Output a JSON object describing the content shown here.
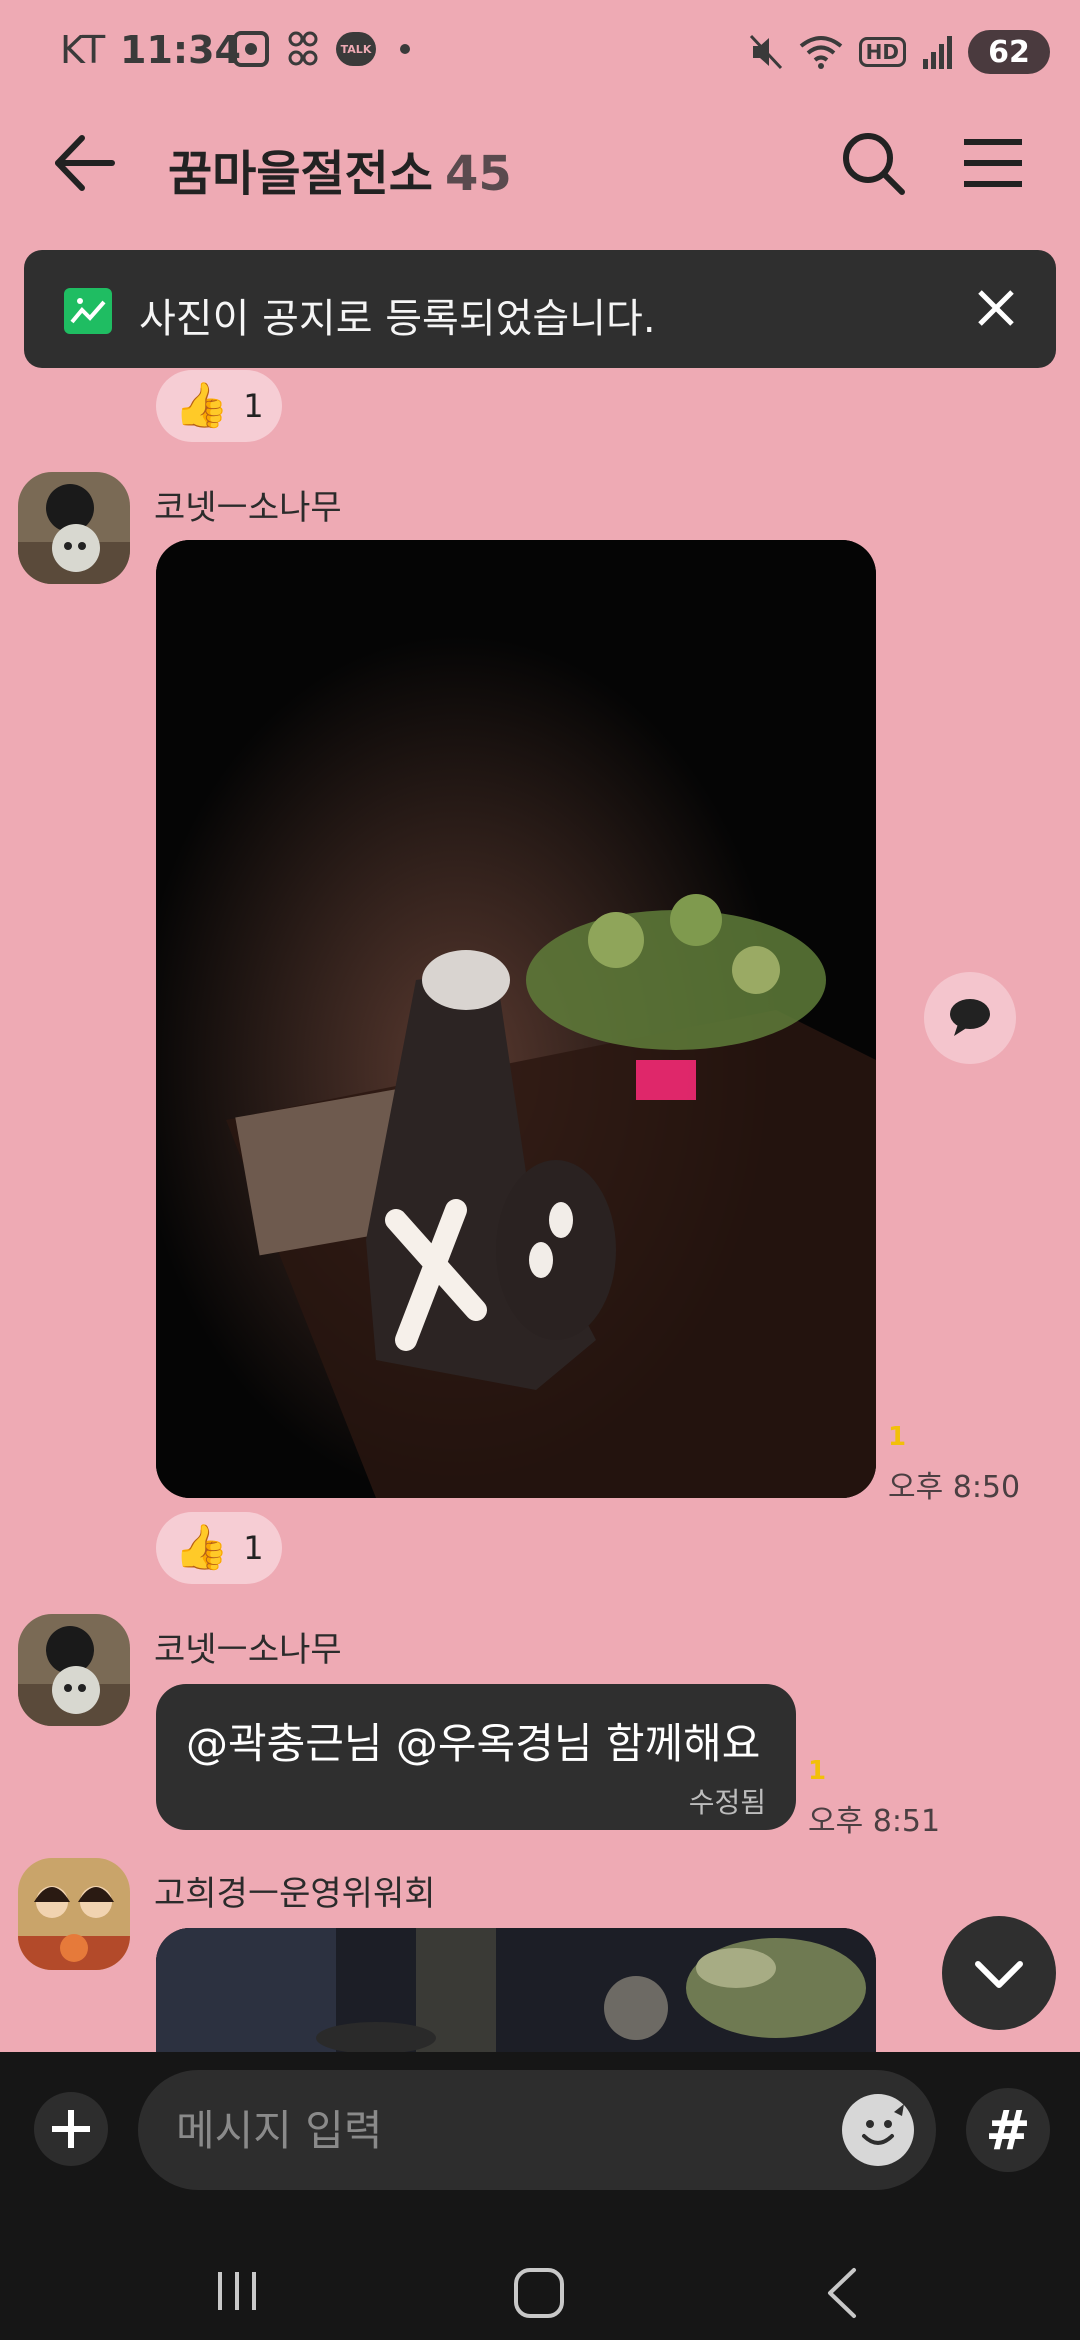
{
  "status_bar": {
    "carrier": "KT",
    "time": "11:34",
    "talk_badge": "TALK",
    "network_label": "HD",
    "battery": "62",
    "icons": [
      "screenshot-icon",
      "app-icon",
      "talk-icon",
      "dot-icon",
      "mute-icon",
      "wifi-icon",
      "hd-icon",
      "signal-icon",
      "battery-icon"
    ]
  },
  "header": {
    "title": "꿈마을절전소",
    "member_count": "45",
    "icons": [
      "back-arrow-icon",
      "search-icon",
      "menu-icon"
    ]
  },
  "notice": {
    "text": "사진이 공지로 등록되었습니다.",
    "icons": [
      "photo-notice-icon",
      "close-icon"
    ]
  },
  "messages": [
    {
      "reaction": {
        "emoji": "👍",
        "count": "1"
      }
    },
    {
      "sender": "코넷ㅡ소나무",
      "type": "photo",
      "unread": "1",
      "time": "오후 8:50",
      "reaction": {
        "emoji": "👍",
        "count": "1"
      }
    },
    {
      "sender": "코넷ㅡ소나무",
      "type": "text",
      "text": "@곽충근님 @우옥경님 함께해요",
      "edited": "수정됨",
      "unread": "1",
      "time": "오후 8:51"
    },
    {
      "sender": "고희경ㅡ운영위워회",
      "type": "photo"
    }
  ],
  "input": {
    "placeholder": "메시지 입력",
    "hashtag": "#"
  },
  "colors": {
    "background": "#eeaab4",
    "bubble_dark": "#2f2f2f",
    "unread": "#f2c00a",
    "notice_icon": "#1fbd62"
  }
}
